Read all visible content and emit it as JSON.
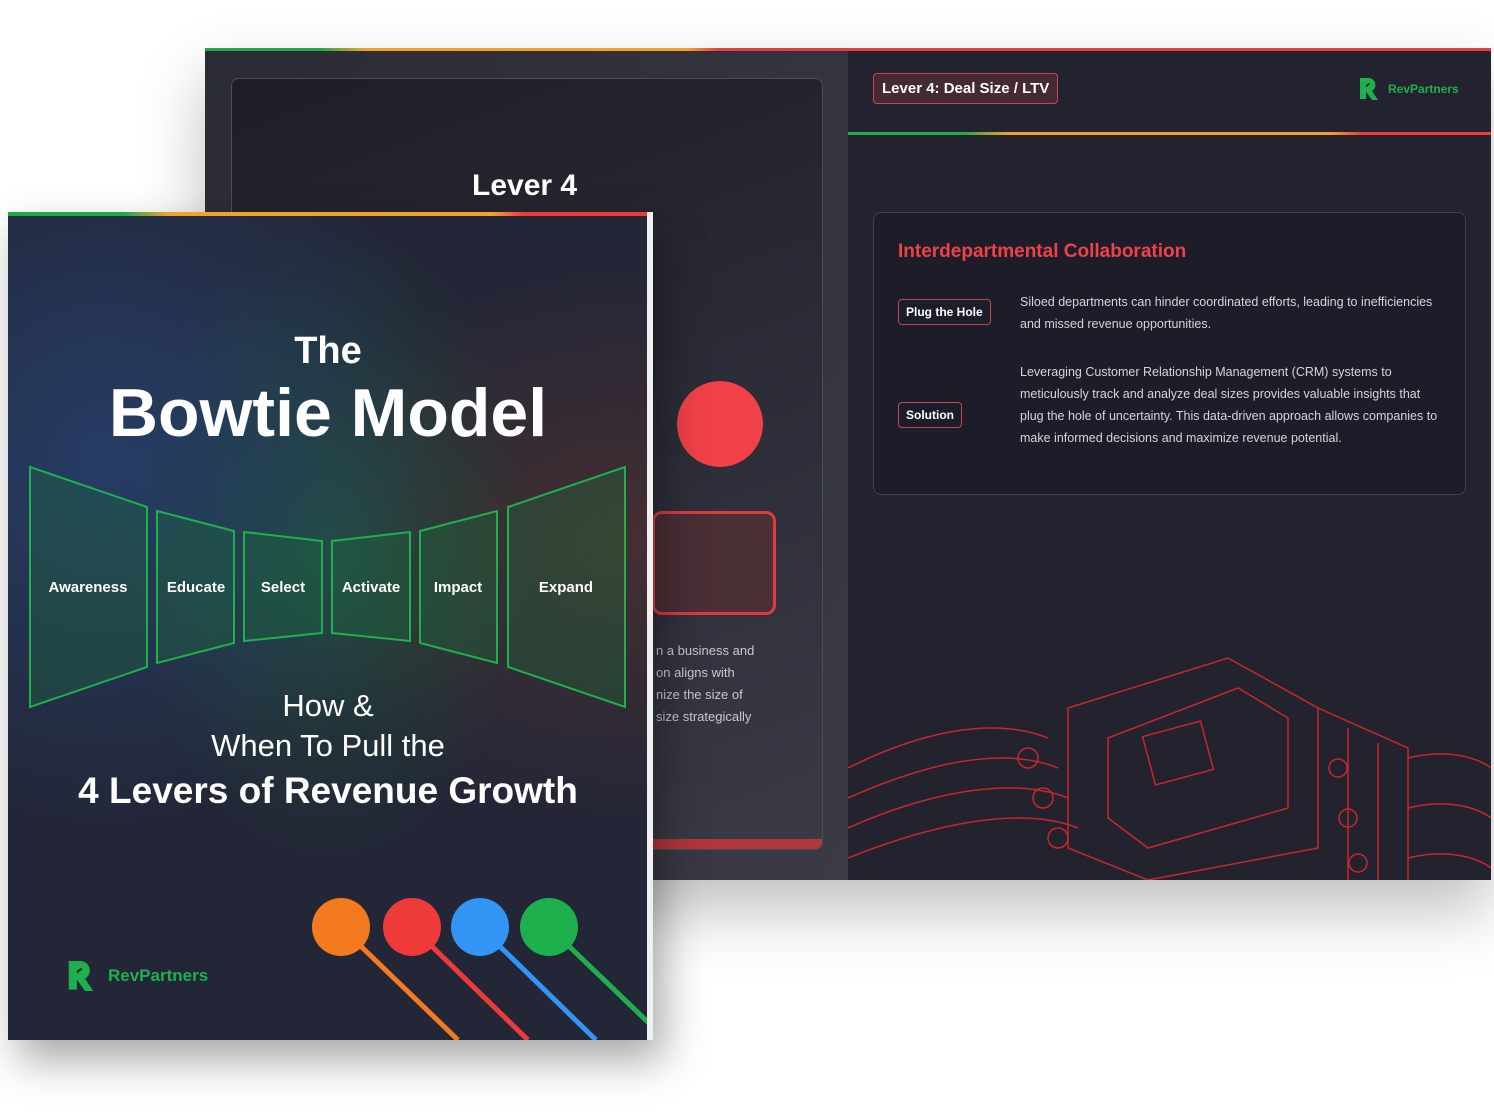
{
  "spread": {
    "left_page": {
      "title": "Lever 4",
      "text_lines": [
        "n a business and",
        "on aligns with",
        "nize the size of",
        "size strategically"
      ]
    },
    "right_page": {
      "badge": "Lever 4: Deal Size / LTV",
      "brand": "RevPartners",
      "card": {
        "title": "Interdepartmental Collaboration",
        "rows": [
          {
            "tag": "Plug the Hole",
            "text": "Siloed departments can hinder coordinated efforts, leading to inefficiencies and missed revenue opportunities."
          },
          {
            "tag": "Solution",
            "text": "Leveraging Customer Relationship Management (CRM) systems to meticulously track and analyze deal sizes provides valuable insights that plug the hole of uncertainty. This data-driven approach allows companies to make informed decisions and maximize revenue potential."
          }
        ]
      }
    }
  },
  "cover": {
    "title_small": "The",
    "title_large": "Bowtie Model",
    "stages": [
      "Awareness",
      "Educate",
      "Select",
      "Activate",
      "Impact",
      "Expand"
    ],
    "subtitle_1": "How &",
    "subtitle_2": "When To Pull the",
    "subtitle_3": "4 Levers of Revenue Growth",
    "brand": "RevPartners"
  },
  "colors": {
    "green": "#1fb04e",
    "orange": "#f47a20",
    "red": "#ef3a3a",
    "blue": "#3494f5",
    "accent_red": "#ef4147",
    "bg": "#232637"
  }
}
